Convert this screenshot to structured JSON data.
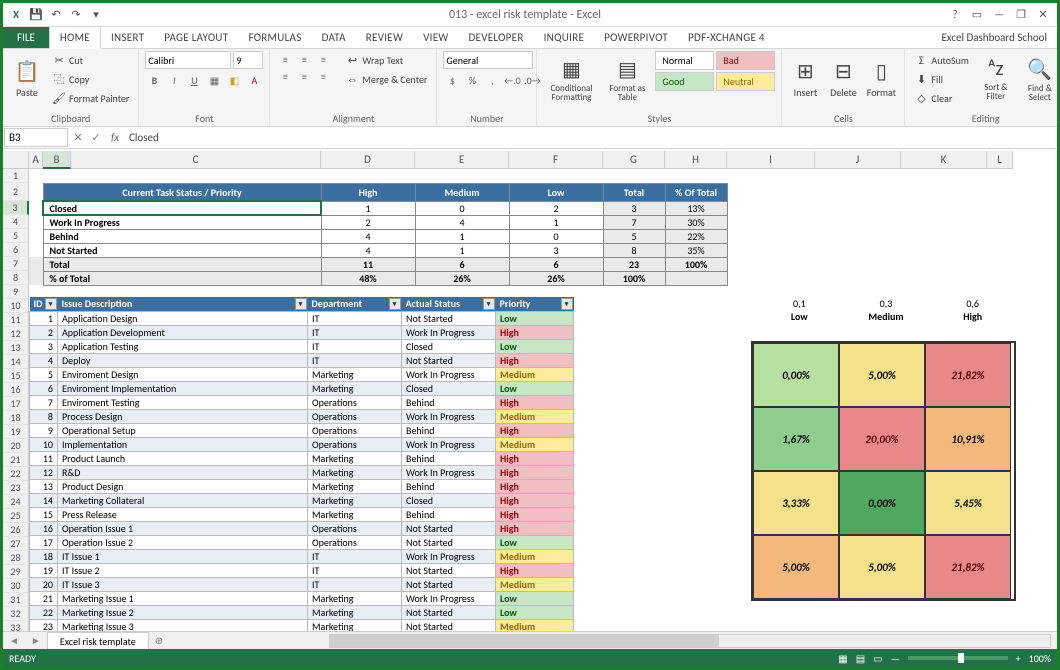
{
  "window": {
    "title": "013 - excel risk template - Excel",
    "right_label": "Excel Dashboard School"
  },
  "tabs": [
    "FILE",
    "HOME",
    "INSERT",
    "PAGE LAYOUT",
    "FORMULAS",
    "DATA",
    "REVIEW",
    "VIEW",
    "DEVELOPER",
    "INQUIRE",
    "POWERPIVOT",
    "PDF-XChange 4"
  ],
  "ribbon": {
    "clipboard": {
      "paste": "Paste",
      "cut": "Cut",
      "copy": "Copy",
      "fp": "Format Painter",
      "label": "Clipboard"
    },
    "font": {
      "name": "Calibri",
      "size": "9",
      "label": "Font"
    },
    "alignment": {
      "wrap": "Wrap Text",
      "merge": "Merge & Center",
      "label": "Alignment"
    },
    "number": {
      "format": "General",
      "label": "Number"
    },
    "styles": {
      "cond": "Conditional Formatting",
      "fmt": "Format as Table",
      "normal": "Normal",
      "bad": "Bad",
      "good": "Good",
      "neutral": "Neutral",
      "label": "Styles"
    },
    "cells": {
      "insert": "Insert",
      "delete": "Delete",
      "format": "Format",
      "label": "Cells"
    },
    "editing": {
      "autosum": "AutoSum",
      "fill": "Fill",
      "clear": "Clear",
      "sort": "Sort & Filter",
      "find": "Find & Select",
      "label": "Editing"
    }
  },
  "formula": {
    "ref": "B3",
    "value": "Closed"
  },
  "columns": [
    "A",
    "B",
    "C",
    "D",
    "E",
    "F",
    "G",
    "H",
    "I",
    "J",
    "K",
    "L"
  ],
  "row_nums": [
    1,
    2,
    3,
    4,
    5,
    6,
    7,
    8,
    9,
    10,
    11,
    12,
    13,
    14,
    15,
    16,
    17,
    18,
    19,
    20,
    21,
    22,
    23,
    24,
    25,
    26,
    27,
    28,
    29,
    30,
    31,
    32,
    33
  ],
  "summary": {
    "header": {
      "status": "Current Task Status / Priority",
      "cols": [
        "High",
        "Medium",
        "Low",
        "Total",
        "% Of Total"
      ]
    },
    "rows": [
      {
        "label": "Closed",
        "v": [
          "1",
          "0",
          "2",
          "3",
          "13%"
        ]
      },
      {
        "label": "Work In Progress",
        "v": [
          "2",
          "4",
          "1",
          "7",
          "30%"
        ]
      },
      {
        "label": "Behind",
        "v": [
          "4",
          "1",
          "0",
          "5",
          "22%"
        ]
      },
      {
        "label": "Not Started",
        "v": [
          "4",
          "1",
          "3",
          "8",
          "35%"
        ]
      },
      {
        "label": "Total",
        "v": [
          "11",
          "6",
          "6",
          "23",
          "100%"
        ]
      },
      {
        "label": "% of Total",
        "v": [
          "48%",
          "26%",
          "26%",
          "100%",
          ""
        ]
      }
    ]
  },
  "issues": {
    "cols": [
      "ID",
      "Issue Description",
      "Department",
      "Actual Status",
      "Priority"
    ],
    "rows": [
      {
        "id": 1,
        "desc": "Application Design",
        "dept": "IT",
        "status": "Not Started",
        "pri": "Low"
      },
      {
        "id": 2,
        "desc": "Application Development",
        "dept": "IT",
        "status": "Work In Progress",
        "pri": "High"
      },
      {
        "id": 3,
        "desc": "Application Testing",
        "dept": "IT",
        "status": "Closed",
        "pri": "Low"
      },
      {
        "id": 4,
        "desc": "Deploy",
        "dept": "IT",
        "status": "Not Started",
        "pri": "High"
      },
      {
        "id": 5,
        "desc": "Enviroment Design",
        "dept": "Marketing",
        "status": "Work In Progress",
        "pri": "Medium"
      },
      {
        "id": 6,
        "desc": "Enviroment Implementation",
        "dept": "Marketing",
        "status": "Closed",
        "pri": "Low"
      },
      {
        "id": 7,
        "desc": "Enviroment Testing",
        "dept": "Operations",
        "status": "Behind",
        "pri": "High"
      },
      {
        "id": 8,
        "desc": "Process Design",
        "dept": "Operations",
        "status": "Work In Progress",
        "pri": "Medium"
      },
      {
        "id": 9,
        "desc": "Operational Setup",
        "dept": "Operations",
        "status": "Behind",
        "pri": "High"
      },
      {
        "id": 10,
        "desc": "Implementation",
        "dept": "Operations",
        "status": "Work In Progress",
        "pri": "Medium"
      },
      {
        "id": 11,
        "desc": "Product Launch",
        "dept": "Marketing",
        "status": "Behind",
        "pri": "High"
      },
      {
        "id": 12,
        "desc": "R&D",
        "dept": "Marketing",
        "status": "Work In Progress",
        "pri": "High"
      },
      {
        "id": 13,
        "desc": "Product Design",
        "dept": "Marketing",
        "status": "Behind",
        "pri": "High"
      },
      {
        "id": 14,
        "desc": "Marketing Collateral",
        "dept": "Marketing",
        "status": "Closed",
        "pri": "High"
      },
      {
        "id": 15,
        "desc": "Press Release",
        "dept": "Marketing",
        "status": "Behind",
        "pri": "High"
      },
      {
        "id": 16,
        "desc": "Operation Issue 1",
        "dept": "Operations",
        "status": "Not Started",
        "pri": "High"
      },
      {
        "id": 17,
        "desc": "Operation Issue 2",
        "dept": "Operations",
        "status": "Not Started",
        "pri": "Low"
      },
      {
        "id": 18,
        "desc": "IT Issue 1",
        "dept": "IT",
        "status": "Work In Progress",
        "pri": "Medium"
      },
      {
        "id": 19,
        "desc": "IT Issue 2",
        "dept": "IT",
        "status": "Not Started",
        "pri": "High"
      },
      {
        "id": 20,
        "desc": "IT Issue 3",
        "dept": "IT",
        "status": "Not Started",
        "pri": "Medium"
      },
      {
        "id": 21,
        "desc": "Marketing Issue 1",
        "dept": "Marketing",
        "status": "Work In Progress",
        "pri": "Low"
      },
      {
        "id": 22,
        "desc": "Marketing Issue 2",
        "dept": "Marketing",
        "status": "Not Started",
        "pri": "Low"
      },
      {
        "id": 23,
        "desc": "Marketing Issue 3",
        "dept": "Marketing",
        "status": "Not Started",
        "pri": "Medium"
      }
    ]
  },
  "matrix": {
    "headers": [
      {
        "v": "0,1",
        "l": "Low"
      },
      {
        "v": "0,3",
        "l": "Medium"
      },
      {
        "v": "0,6",
        "l": "High"
      }
    ],
    "cells": [
      [
        "0,00%",
        "5,00%",
        "21,82%"
      ],
      [
        "1,67%",
        "20,00%",
        "10,91%"
      ],
      [
        "3,33%",
        "0,00%",
        "5,45%"
      ],
      [
        "5,00%",
        "5,00%",
        "21,82%"
      ]
    ],
    "colors": [
      [
        "lg",
        "y",
        "r"
      ],
      [
        "g",
        "r",
        "o"
      ],
      [
        "y",
        "dg",
        "y"
      ],
      [
        "o",
        "y",
        "r"
      ]
    ]
  },
  "sheet": {
    "name": "Excel risk template"
  },
  "status": {
    "ready": "READY",
    "zoom": "100%"
  },
  "chart_data": [
    {
      "type": "table",
      "title": "Current Task Status / Priority",
      "columns": [
        "Status",
        "High",
        "Medium",
        "Low",
        "Total",
        "% Of Total"
      ],
      "rows": [
        [
          "Closed",
          1,
          0,
          2,
          3,
          "13%"
        ],
        [
          "Work In Progress",
          2,
          4,
          1,
          7,
          "30%"
        ],
        [
          "Behind",
          4,
          1,
          0,
          5,
          "22%"
        ],
        [
          "Not Started",
          4,
          1,
          3,
          8,
          "35%"
        ],
        [
          "Total",
          11,
          6,
          6,
          23,
          "100%"
        ],
        [
          "% of Total",
          "48%",
          "26%",
          "26%",
          "100%",
          ""
        ]
      ]
    },
    {
      "type": "heatmap",
      "title": "Risk matrix",
      "x_categories": [
        "Low (0,1)",
        "Medium (0,3)",
        "High (0,6)"
      ],
      "rows": 4,
      "values": [
        [
          0.0,
          5.0,
          21.82
        ],
        [
          1.67,
          20.0,
          10.91
        ],
        [
          3.33,
          0.0,
          5.45
        ],
        [
          5.0,
          5.0,
          21.82
        ]
      ],
      "unit": "%"
    }
  ]
}
